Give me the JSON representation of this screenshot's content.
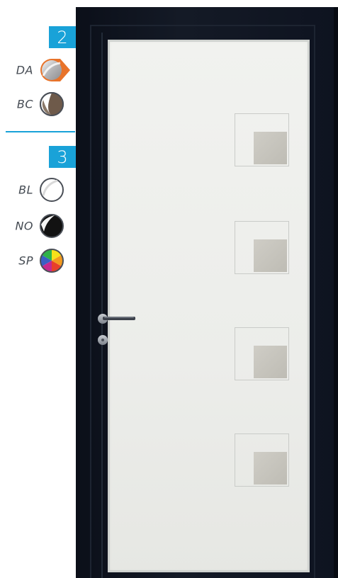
{
  "steps": [
    {
      "number": "2",
      "options": [
        {
          "code": "DA",
          "icon": "metallic-swatch-icon",
          "selected": true
        },
        {
          "code": "BC",
          "icon": "brown-swatch-icon",
          "selected": false
        }
      ]
    },
    {
      "number": "3",
      "options": [
        {
          "code": "BL",
          "icon": "white-swatch-icon",
          "selected": false
        },
        {
          "code": "NO",
          "icon": "black-swatch-icon",
          "selected": false
        },
        {
          "code": "SP",
          "icon": "rainbow-swatch-icon",
          "selected": false
        }
      ]
    }
  ],
  "colors": {
    "accent": "#19a2d8",
    "selected_ring": "#e8732a",
    "door_frame": "#0d1220",
    "panel": "#ecedea",
    "glass": "#c7c5be"
  }
}
